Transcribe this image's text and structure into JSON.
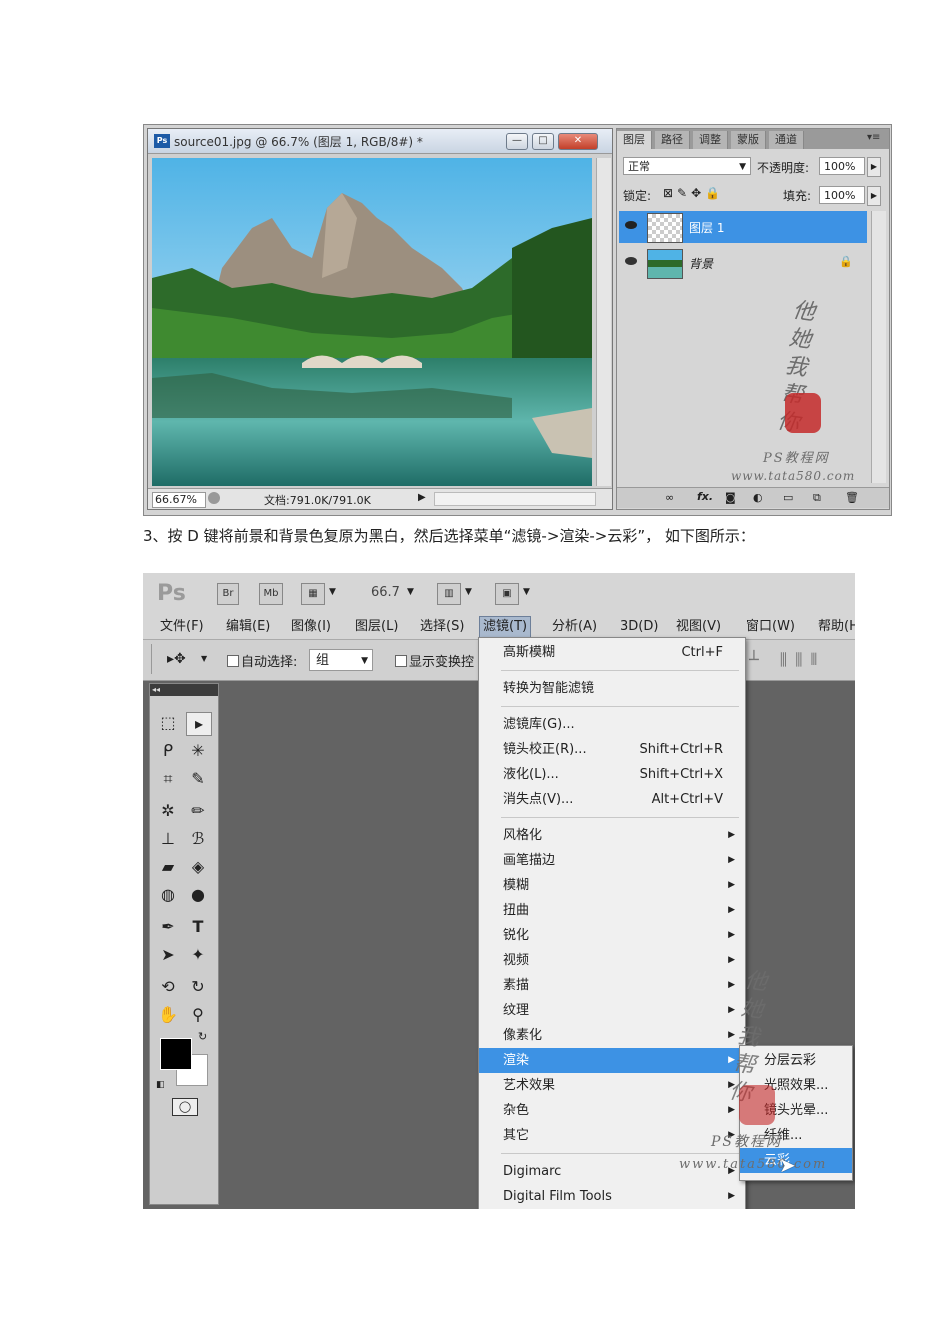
{
  "shot1": {
    "doc_title": "source01.jpg @ 66.7% (图层 1, RGB/8#) *",
    "ps_badge": "Ps",
    "zoom": "66.67%",
    "doc_size": "文档:791.0K/791.0K",
    "panel_tabs": [
      "图层",
      "路径",
      "调整",
      "蒙版",
      "通道"
    ],
    "blend_mode": "正常",
    "opacity_label": "不透明度:",
    "opacity_value": "100%",
    "lock_label": "锁定:",
    "fill_label": "填充:",
    "fill_value": "100%",
    "layers": [
      {
        "name": "图层 1",
        "selected": true
      },
      {
        "name": "背景",
        "selected": false
      }
    ],
    "footer_icons": [
      "link-icon",
      "fx-icon",
      "mask-icon",
      "adjustment-icon",
      "folder-icon",
      "new-layer-icon",
      "trash-icon"
    ],
    "footer_fx": "fx."
  },
  "watermark": {
    "text": "他她我帮你",
    "line1": "PS教程网",
    "line2": "www.tata580.com"
  },
  "caption": "3、按 D 键将前景和背景色复原为黑白，然后选择菜单“滤镜->渲染->云彩”， 如下图所示：",
  "shot2": {
    "logo": "Ps",
    "app_buttons": [
      "Br",
      "Mb"
    ],
    "zoom": "66.7",
    "menus": [
      "文件(F)",
      "编辑(E)",
      "图像(I)",
      "图层(L)",
      "选择(S)",
      "滤镜(T)",
      "分析(A)",
      "3D(D)",
      "视图(V)",
      "窗口(W)",
      "帮助(H"
    ],
    "active_menu": "滤镜(T)",
    "options": {
      "auto_select": "自动选择:",
      "group_value": "组",
      "show_transform": "显示变换控"
    },
    "filter_menu": [
      {
        "label": "高斯模糊",
        "shortcut": "Ctrl+F"
      },
      {
        "sep": true
      },
      {
        "label": "转换为智能滤镜"
      },
      {
        "sep": true
      },
      {
        "label": "滤镜库(G)..."
      },
      {
        "label": "镜头校正(R)...",
        "shortcut": "Shift+Ctrl+R"
      },
      {
        "label": "液化(L)...",
        "shortcut": "Shift+Ctrl+X"
      },
      {
        "label": "消失点(V)...",
        "shortcut": "Alt+Ctrl+V"
      },
      {
        "sep": true
      },
      {
        "label": "风格化",
        "sub": true
      },
      {
        "label": "画笔描边",
        "sub": true
      },
      {
        "label": "模糊",
        "sub": true
      },
      {
        "label": "扭曲",
        "sub": true
      },
      {
        "label": "锐化",
        "sub": true
      },
      {
        "label": "视频",
        "sub": true
      },
      {
        "label": "素描",
        "sub": true
      },
      {
        "label": "纹理",
        "sub": true
      },
      {
        "label": "像素化",
        "sub": true
      },
      {
        "label": "渲染",
        "sub": true,
        "highlight": true
      },
      {
        "label": "艺术效果",
        "sub": true
      },
      {
        "label": "杂色",
        "sub": true
      },
      {
        "label": "其它",
        "sub": true
      },
      {
        "sep": true
      },
      {
        "label": "Digimarc",
        "sub": true
      },
      {
        "label": "Digital Film Tools",
        "sub": true
      }
    ],
    "render_submenu": [
      {
        "label": "分层云彩"
      },
      {
        "label": "光照效果..."
      },
      {
        "label": "镜头光晕..."
      },
      {
        "label": "纤维..."
      },
      {
        "label": "云彩",
        "highlight": true
      }
    ]
  }
}
